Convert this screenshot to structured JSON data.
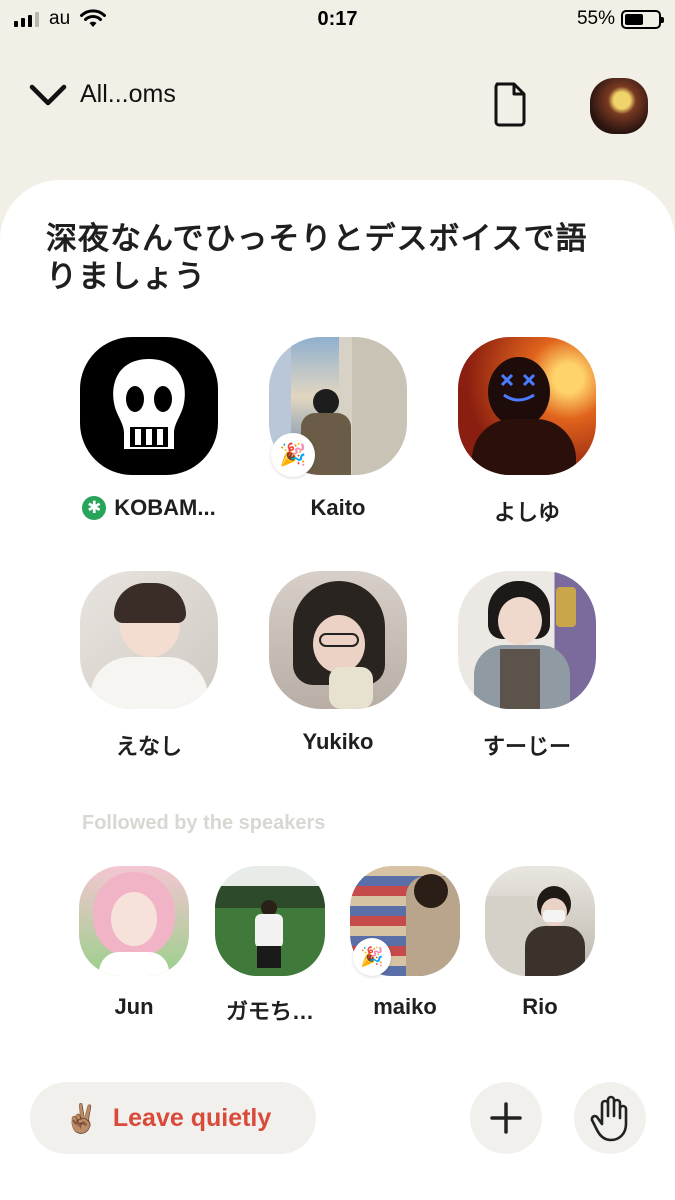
{
  "status_bar": {
    "carrier": "au",
    "time": "0:17",
    "battery_text": "55%",
    "battery_level": 0.55
  },
  "nav": {
    "back_label": "All...oms",
    "icons": [
      "chevron-down-icon",
      "document-icon"
    ]
  },
  "room": {
    "title": "深夜なんでひっそりとデスボイスで語りましょう"
  },
  "speakers": [
    {
      "name": "KOBAM...",
      "moderator": true,
      "moderator_glyph": "✱"
    },
    {
      "name": "Kaito",
      "badge": "🎉"
    },
    {
      "name": "よしゆ"
    },
    {
      "name": "えなし"
    },
    {
      "name": "Yukiko"
    },
    {
      "name": "すーじー"
    }
  ],
  "followed_section": {
    "label": "Followed by the speakers",
    "people": [
      {
        "name": "Jun"
      },
      {
        "name": "ガモち…"
      },
      {
        "name": "maiko",
        "badge": "🎉"
      },
      {
        "name": "Rio"
      }
    ]
  },
  "actions": {
    "leave_label": "Leave quietly",
    "leave_emoji": "✌🏽",
    "add_icon": "plus-icon",
    "hand_icon": "raise-hand-icon"
  },
  "colors": {
    "background": "#f2efe6",
    "card": "#ffffff",
    "leave_text": "#d84a3a",
    "moderator_badge": "#27a35a"
  }
}
